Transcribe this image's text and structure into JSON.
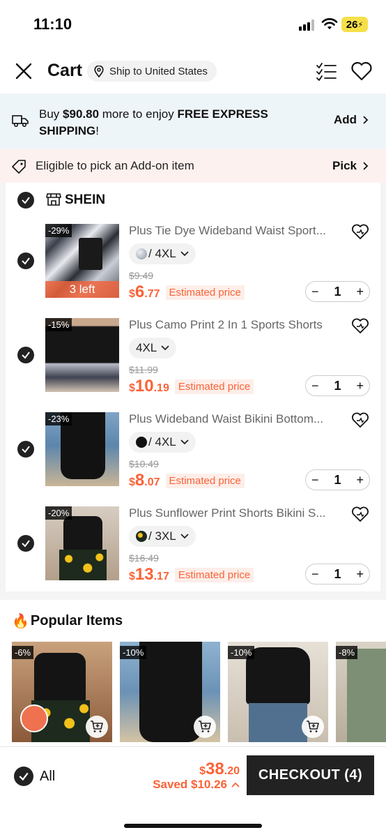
{
  "status": {
    "time": "11:10",
    "battery": "26"
  },
  "header": {
    "title": "Cart",
    "ship_to": "Ship to United States"
  },
  "shipping_banner": {
    "prefix": "Buy ",
    "amount": "$90.80",
    "middle": " more to enjoy ",
    "highlight": "FREE EXPRESS SHIPPING",
    "suffix": "!",
    "action": "Add"
  },
  "addon_banner": {
    "text": "Eligible to pick an Add-on item",
    "action": "Pick"
  },
  "store": {
    "name": "SHEIN"
  },
  "items": [
    {
      "discount": "-29%",
      "stock_note": "3 left",
      "title": "Plus Tie Dye Wideband Waist Sport...",
      "variant": "/ 4XL",
      "original_price": "$9.49",
      "price_currency": "$",
      "price_int": "6",
      "price_dec": ".77",
      "price_note": "Estimated price",
      "qty": "1",
      "swatch_color": "#b8bfcc"
    },
    {
      "discount": "-15%",
      "title": "Plus Camo Print 2 In 1 Sports Shorts",
      "variant": "4XL",
      "original_price": "$11.99",
      "price_currency": "$",
      "price_int": "10",
      "price_dec": ".19",
      "price_note": "Estimated price",
      "qty": "1"
    },
    {
      "discount": "-23%",
      "title": "Plus Wideband Waist Bikini Bottom...",
      "variant": "/ 4XL",
      "original_price": "$10.49",
      "price_currency": "$",
      "price_int": "8",
      "price_dec": ".07",
      "price_note": "Estimated price",
      "qty": "1",
      "swatch_color": "#111111"
    },
    {
      "discount": "-20%",
      "title": "Plus Sunflower Print Shorts Bikini S...",
      "variant": "/ 3XL",
      "original_price": "$16.49",
      "price_currency": "$",
      "price_int": "13",
      "price_dec": ".17",
      "price_note": "Estimated price",
      "qty": "1",
      "swatch_color": "#2a3a2a"
    }
  ],
  "popular": {
    "title": "Popular Items",
    "items": [
      {
        "discount": "-6%"
      },
      {
        "discount": "-10%"
      },
      {
        "discount": "-10%"
      },
      {
        "discount": "-8%"
      }
    ]
  },
  "bottom": {
    "all_label": "All",
    "total_currency": "$",
    "total_int": "38",
    "total_dec": ".20",
    "saved": "Saved $10.26",
    "checkout": "CHECKOUT (4)"
  },
  "colors": {
    "accent": "#fa6338",
    "dark": "#222222"
  }
}
